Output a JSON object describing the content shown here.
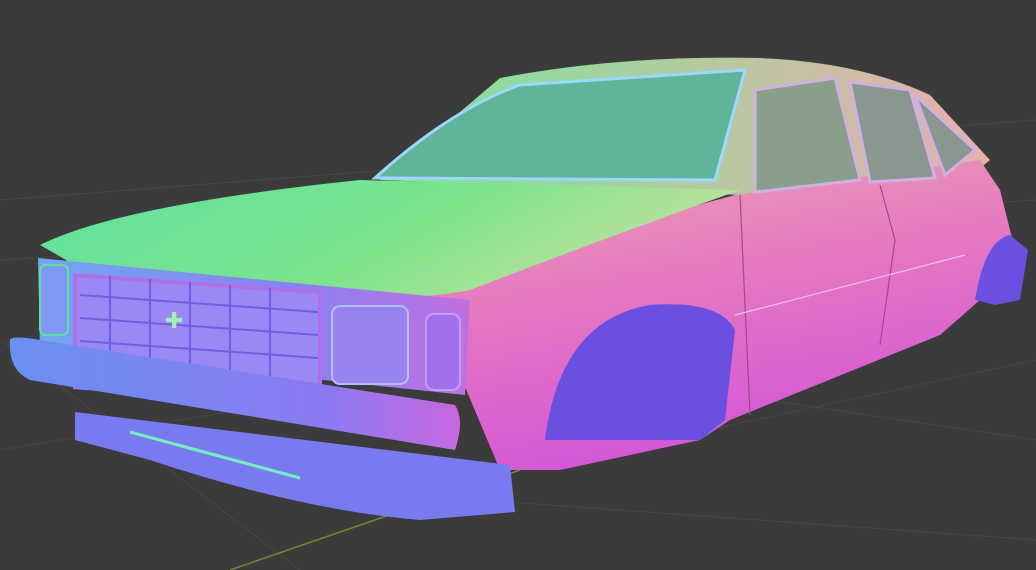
{
  "viewport": {
    "background_color": "#3b3b3b",
    "grid_color": "#484848",
    "x_axis_color": "#6e8a2e"
  },
  "model": {
    "shading": "normal-map",
    "colors": {
      "hood": "#6ee08c",
      "roof": "#9fe6a0",
      "side": "#e37ac4",
      "side_lower": "#d85fd0",
      "front": "#7c86f0",
      "bumper": "#8a7cf2",
      "window": "#4f9c8c",
      "wheel_well": "#6a4fe0"
    }
  }
}
